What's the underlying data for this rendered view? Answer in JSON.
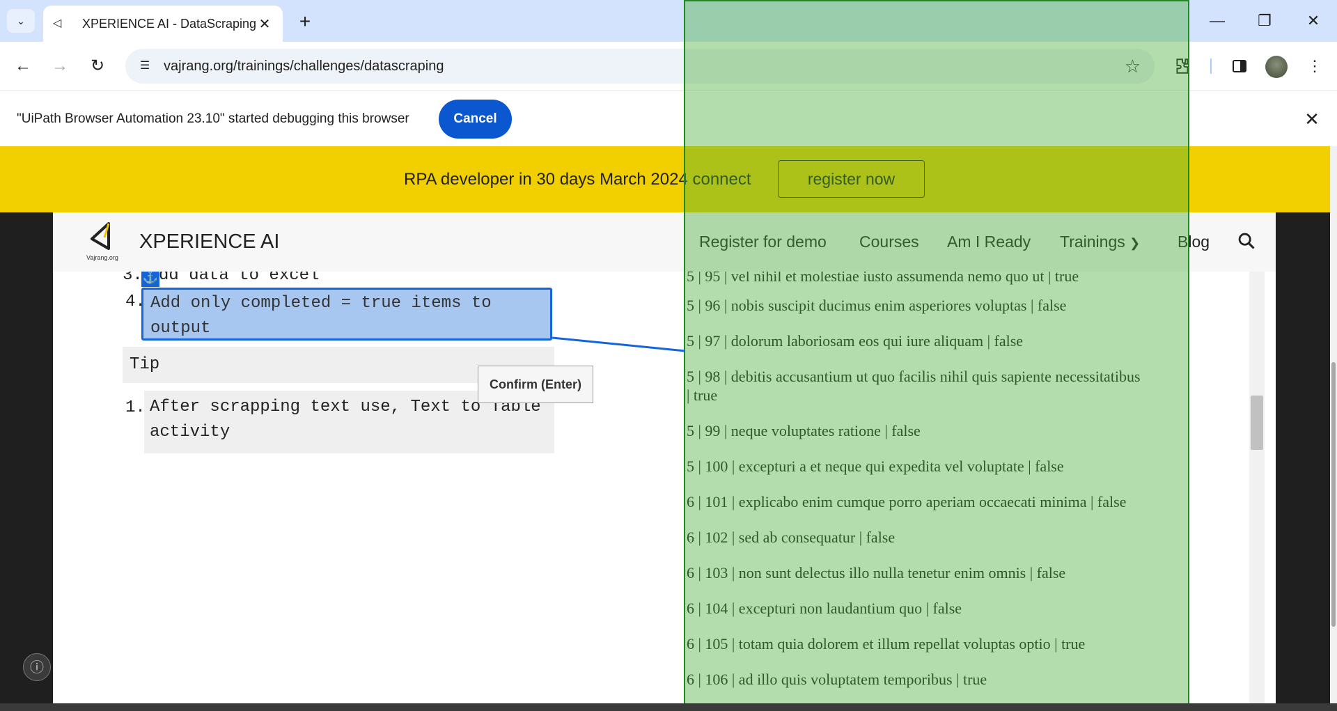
{
  "browser": {
    "tab": {
      "title": "XPERIENCE AI - DataScraping",
      "favicon": "vajrang-logo-icon",
      "close": "✕"
    },
    "new_tab": "+",
    "window_controls": {
      "minimize": "—",
      "restore": "❐",
      "close": "✕"
    },
    "nav": {
      "back": "←",
      "forward": "→",
      "reload": "↻"
    },
    "url": "vajrang.org/trainings/challenges/datascraping",
    "bookmark_icon": "☆",
    "extensions_icon": "puzzle-icon",
    "sidepanel_icon": "side-panel-icon",
    "menu_icon": "⋮"
  },
  "debug_infobar": {
    "message": "\"UiPath Browser Automation 23.10\" started debugging this browser",
    "cancel_label": "Cancel",
    "close": "✕"
  },
  "banner": {
    "text": "RPA developer in 30 days March 2024 connect",
    "button_label": "register now",
    "color": "#f2d000"
  },
  "site_nav": {
    "brand": "XPERIENCE AI",
    "logo_caption": "Vajrang.org",
    "items": [
      {
        "label": "Register for demo"
      },
      {
        "label": "Courses"
      },
      {
        "label": "Am I Ready"
      },
      {
        "label": "Trainings"
      },
      {
        "label": "Blog"
      }
    ]
  },
  "instructions": {
    "step3_number": "3.",
    "step3_text": "dd data to excel",
    "step4_number": "4.",
    "step4_text_line1": "Add only completed = true items to",
    "step4_text_line2": "output",
    "tip_label": "Tip",
    "tip_number": "1.",
    "tip_text_line1": "After scrapping text use, Text to Table",
    "tip_text_line2": "activity"
  },
  "selection_overlay": {
    "confirm_label": "Confirm (Enter)",
    "anchor_icon": "⚓",
    "highlight_color": "#4caf3c",
    "selection_color": "#1565d8"
  },
  "data_rows": [
    {
      "text": "5 | 95 | vel nihil et molestiae iusto assumenda nemo quo ut | true"
    },
    {
      "text": "5 | 96 | nobis suscipit ducimus enim asperiores voluptas | false"
    },
    {
      "text": "5 | 97 | dolorum laboriosam eos qui iure aliquam | false"
    },
    {
      "text": "5 | 98 | debitis accusantium ut quo facilis nihil quis sapiente necessitatibus",
      "text2": "| true"
    },
    {
      "text": "5 | 99 | neque voluptates ratione | false"
    },
    {
      "text": "5 | 100 | excepturi a et neque qui expedita vel voluptate | false"
    },
    {
      "text": "6 | 101 | explicabo enim cumque porro aperiam occaecati minima | false"
    },
    {
      "text": "6 | 102 | sed ab consequatur | false"
    },
    {
      "text": "6 | 103 | non sunt delectus illo nulla tenetur enim omnis | false"
    },
    {
      "text": "6 | 104 | excepturi non laudantium quo | false"
    },
    {
      "text": "6 | 105 | totam quia dolorem et illum repellat voluptas optio | true"
    },
    {
      "text": "6 | 106 | ad illo quis voluptatem temporibus | true"
    }
  ],
  "info_button": "ⓘ"
}
